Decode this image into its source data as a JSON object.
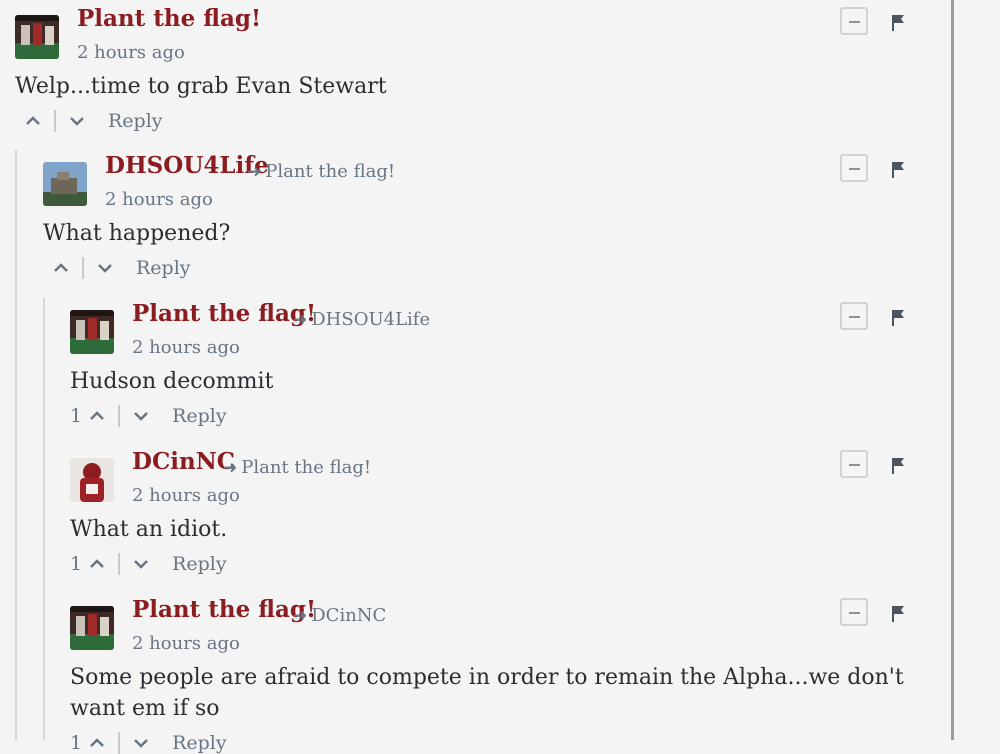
{
  "comments": [
    {
      "author": "Plant the flag!",
      "reply_to": "",
      "time": "2 hours ago",
      "body": "Welp...time to grab Evan Stewart",
      "votes": "",
      "reply_label": "Reply",
      "avatar": "avatar-football-team"
    },
    {
      "author": "DHSOU4Life",
      "reply_to": "Plant the flag!",
      "time": "2 hours ago",
      "body": "What happened?",
      "votes": "",
      "reply_label": "Reply",
      "avatar": "avatar-building"
    },
    {
      "author": "Plant the flag!",
      "reply_to": "DHSOU4Life",
      "time": "2 hours ago",
      "body": "Hudson decommit",
      "votes": "1",
      "reply_label": "Reply",
      "avatar": "avatar-football-team"
    },
    {
      "author": "DCinNC",
      "reply_to": "Plant the flag!",
      "time": "2 hours ago",
      "body": "What an idiot.",
      "votes": "1",
      "reply_label": "Reply",
      "avatar": "avatar-football-player"
    },
    {
      "author": "Plant the flag!",
      "reply_to": "DCinNC",
      "time": "2 hours ago",
      "body": "Some people are afraid to compete in order to remain the Alpha...we don't want em if so",
      "votes": "1",
      "reply_label": "Reply",
      "avatar": "avatar-football-team"
    }
  ],
  "colors": {
    "author": "#8b1c1f",
    "meta": "#687583",
    "body": "#2a2e33",
    "background": "#f4f4f5"
  }
}
